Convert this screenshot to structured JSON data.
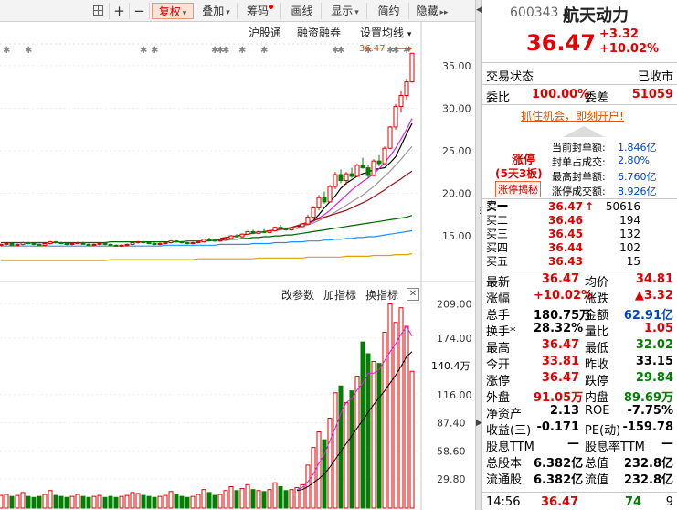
{
  "toolbar": {
    "buttons": [
      {
        "label": "",
        "name": "layout-button",
        "icon": "grid-icon"
      },
      {
        "label": "+",
        "name": "zoom-in-button"
      },
      {
        "label": "−",
        "name": "zoom-out-button"
      },
      {
        "label": "复权",
        "name": "adjust-button",
        "caret": "▾",
        "active": true
      },
      {
        "label": "叠加",
        "name": "overlay-button",
        "caret": "▾"
      },
      {
        "label": "筹码",
        "name": "chips-button",
        "dot": true
      },
      {
        "label": "画线",
        "name": "draw-button"
      },
      {
        "label": "显示",
        "name": "display-button",
        "caret": "▾"
      },
      {
        "label": "简约",
        "name": "simple-button"
      },
      {
        "label": "隐藏",
        "name": "hide-button",
        "caret": "▸▸"
      }
    ]
  },
  "main_chart": {
    "links": [
      "沪股通",
      "融资融券",
      "设置均线"
    ],
    "setting_caret": "▾",
    "last_price_label": "36.47",
    "star_marker": "✱",
    "y_ticks": [
      "35.00",
      "30.00",
      "25.00",
      "20.00",
      "15.00"
    ],
    "y_tick_values": [
      35,
      30,
      25,
      20,
      15
    ],
    "colors": {
      "up": "#e00000",
      "down": "#008000",
      "ma5": "#000000",
      "ma10": "#e020e0",
      "ma20": "#9a9a9a",
      "ma30": "#a01010",
      "ma60": "#006400",
      "ma120": "#1e90ff",
      "ma250": "#e0a000"
    }
  },
  "volume_chart": {
    "links": [
      "改参数",
      "加指标",
      "换指标"
    ],
    "close_icon": "✕",
    "y_ticks": [
      "209.00",
      "174.00",
      "116.00",
      "87.40",
      "58.60",
      "29.80"
    ],
    "y_tick_values": [
      209,
      174,
      116,
      87.4,
      58.6,
      29.8
    ],
    "current_label": "140.4万"
  },
  "chart_data": {
    "type": "candlestick",
    "price_ylim": [
      12,
      38
    ],
    "volume_ylim": [
      0,
      215
    ],
    "candles": [
      [
        13.9,
        14.1,
        13.8,
        14.0,
        13
      ],
      [
        14.0,
        14.2,
        13.9,
        14.1,
        14
      ],
      [
        14.1,
        14.2,
        13.9,
        13.9,
        12
      ],
      [
        13.9,
        14.1,
        13.8,
        14.0,
        13
      ],
      [
        14.0,
        14.3,
        13.9,
        14.2,
        16
      ],
      [
        14.2,
        14.3,
        14.0,
        14.1,
        12
      ],
      [
        14.1,
        14.2,
        13.9,
        14.0,
        11
      ],
      [
        14.0,
        14.1,
        13.8,
        13.9,
        12
      ],
      [
        13.9,
        14.2,
        13.8,
        14.1,
        14
      ],
      [
        14.1,
        14.4,
        14.0,
        14.3,
        18
      ],
      [
        14.3,
        14.4,
        14.1,
        14.2,
        13
      ],
      [
        14.2,
        14.3,
        14.0,
        14.1,
        12
      ],
      [
        14.1,
        14.2,
        13.9,
        14.0,
        11
      ],
      [
        14.0,
        14.2,
        13.9,
        14.1,
        12
      ],
      [
        14.1,
        14.3,
        14.0,
        14.2,
        14
      ],
      [
        14.2,
        14.3,
        14.0,
        14.0,
        12
      ],
      [
        14.0,
        14.1,
        13.8,
        13.9,
        11
      ],
      [
        13.9,
        14.1,
        13.8,
        14.0,
        12
      ],
      [
        14.0,
        14.2,
        13.9,
        14.1,
        13
      ],
      [
        14.1,
        14.2,
        13.9,
        14.0,
        11
      ],
      [
        14.0,
        14.1,
        13.8,
        13.9,
        12
      ],
      [
        13.9,
        14.0,
        13.7,
        13.8,
        11
      ],
      [
        13.8,
        14.0,
        13.7,
        13.9,
        12
      ],
      [
        13.9,
        14.1,
        13.8,
        14.0,
        13
      ],
      [
        14.0,
        14.3,
        13.9,
        14.2,
        16
      ],
      [
        14.2,
        14.4,
        14.1,
        14.3,
        15
      ],
      [
        14.3,
        14.4,
        14.1,
        14.2,
        13
      ],
      [
        14.2,
        14.3,
        14.0,
        14.1,
        12
      ],
      [
        14.1,
        14.2,
        13.9,
        14.0,
        11
      ],
      [
        14.0,
        14.2,
        13.9,
        14.1,
        12
      ],
      [
        14.1,
        14.3,
        14.0,
        14.2,
        13
      ],
      [
        14.2,
        14.5,
        14.1,
        14.4,
        17
      ],
      [
        14.4,
        14.5,
        14.2,
        14.3,
        14
      ],
      [
        14.3,
        14.4,
        14.1,
        14.2,
        12
      ],
      [
        14.2,
        14.3,
        14.0,
        14.1,
        11
      ],
      [
        14.1,
        14.3,
        14.0,
        14.2,
        12
      ],
      [
        14.2,
        14.4,
        14.1,
        14.3,
        14
      ],
      [
        14.3,
        14.7,
        14.2,
        14.6,
        19
      ],
      [
        14.6,
        14.8,
        14.4,
        14.5,
        16
      ],
      [
        14.5,
        14.6,
        14.3,
        14.4,
        13
      ],
      [
        14.4,
        14.6,
        14.3,
        14.5,
        14
      ],
      [
        14.5,
        14.8,
        14.4,
        14.7,
        18
      ],
      [
        14.7,
        15.1,
        14.6,
        15.0,
        22
      ],
      [
        15.0,
        15.2,
        14.8,
        14.9,
        18
      ],
      [
        14.9,
        15.3,
        14.8,
        15.2,
        20
      ],
      [
        15.2,
        15.6,
        15.1,
        15.5,
        24
      ],
      [
        15.5,
        15.7,
        15.2,
        15.3,
        19
      ],
      [
        15.3,
        15.6,
        15.2,
        15.5,
        18
      ],
      [
        15.5,
        15.8,
        15.3,
        15.4,
        17
      ],
      [
        15.4,
        15.7,
        15.3,
        15.6,
        19
      ],
      [
        15.6,
        16.1,
        15.5,
        16.0,
        26
      ],
      [
        16.0,
        16.3,
        15.8,
        15.9,
        22
      ],
      [
        15.9,
        16.0,
        15.6,
        15.7,
        18
      ],
      [
        15.7,
        16.0,
        15.6,
        15.9,
        19
      ],
      [
        15.9,
        16.2,
        15.8,
        16.1,
        21
      ],
      [
        16.1,
        16.5,
        16.0,
        16.4,
        24
      ],
      [
        16.4,
        17.5,
        16.3,
        17.2,
        44
      ],
      [
        17.2,
        18.5,
        17.0,
        18.3,
        62
      ],
      [
        18.3,
        19.8,
        18.0,
        19.5,
        78
      ],
      [
        19.5,
        20.2,
        18.8,
        19.0,
        70
      ],
      [
        19.0,
        21.0,
        18.9,
        20.8,
        92
      ],
      [
        20.8,
        22.5,
        20.5,
        22.2,
        118
      ],
      [
        22.2,
        22.8,
        21.2,
        21.5,
        125
      ],
      [
        21.5,
        22.5,
        21.0,
        22.3,
        108
      ],
      [
        22.3,
        23.0,
        21.8,
        22.0,
        120
      ],
      [
        22.0,
        23.5,
        21.9,
        23.3,
        135
      ],
      [
        23.3,
        24.2,
        22.9,
        23.0,
        170
      ],
      [
        23.0,
        23.4,
        21.8,
        22.1,
        158
      ],
      [
        22.1,
        24.0,
        22.0,
        23.8,
        150
      ],
      [
        23.8,
        24.5,
        23.2,
        23.5,
        148
      ],
      [
        23.5,
        25.5,
        23.4,
        25.3,
        180
      ],
      [
        25.3,
        27.9,
        25.2,
        27.8,
        209
      ],
      [
        27.8,
        30.5,
        27.5,
        30.2,
        190
      ],
      [
        30.2,
        32.0,
        29.5,
        31.5,
        205
      ],
      [
        31.5,
        33.5,
        31.0,
        33.1,
        186
      ],
      [
        33.1,
        36.47,
        33.0,
        36.47,
        140
      ]
    ],
    "ma_lines": [
      {
        "key": "ma5",
        "from": 54,
        "values": [
          16.1,
          16.2,
          16.4,
          16.8,
          17.5,
          18.3,
          19.0,
          19.7,
          20.6,
          21.2,
          21.6,
          22.0,
          22.3,
          22.5,
          22.8,
          22.9,
          23.0,
          23.6,
          24.3,
          25.6,
          27.0,
          28.2
        ]
      },
      {
        "key": "ma10",
        "from": 52,
        "values": [
          15.8,
          15.9,
          16.0,
          16.1,
          16.4,
          16.7,
          17.1,
          17.5,
          18.0,
          18.6,
          19.2,
          19.8,
          20.4,
          20.9,
          21.4,
          21.8,
          22.3,
          22.9,
          23.6,
          24.4,
          25.3,
          26.4,
          27.5,
          28.8
        ]
      },
      {
        "key": "ma20",
        "from": 50,
        "values": [
          15.6,
          15.7,
          15.8,
          15.9,
          16.0,
          16.1,
          16.3,
          16.5,
          16.8,
          17.1,
          17.4,
          17.8,
          18.2,
          18.6,
          19.0,
          19.4,
          19.8,
          20.3,
          20.8,
          21.4,
          22.0,
          22.6,
          23.3,
          24.0,
          24.8,
          25.5
        ]
      },
      {
        "key": "ma30",
        "from": 40,
        "values": [
          14.7,
          14.8,
          14.9,
          15.0,
          15.1,
          15.2,
          15.3,
          15.4,
          15.5,
          15.6,
          15.7,
          15.8,
          15.9,
          16.0,
          16.2,
          16.4,
          16.6,
          16.8,
          17.0,
          17.2,
          17.4,
          17.6,
          17.8,
          18.0,
          18.3,
          18.6,
          18.9,
          19.2,
          19.6,
          20.0,
          20.4,
          20.9,
          21.3,
          21.7,
          22.2,
          22.6
        ]
      },
      {
        "key": "ma60",
        "from": 0,
        "values": [
          14.2,
          14.2,
          14.2,
          14.2,
          14.2,
          14.2,
          14.2,
          14.2,
          14.2,
          14.2,
          14.2,
          14.2,
          14.2,
          14.2,
          14.2,
          14.2,
          14.2,
          14.2,
          14.2,
          14.2,
          14.3,
          14.3,
          14.3,
          14.3,
          14.3,
          14.3,
          14.3,
          14.3,
          14.3,
          14.3,
          14.3,
          14.3,
          14.3,
          14.3,
          14.4,
          14.4,
          14.4,
          14.4,
          14.4,
          14.5,
          14.5,
          14.5,
          14.6,
          14.6,
          14.7,
          14.7,
          14.8,
          14.8,
          14.9,
          14.9,
          15.0,
          15.0,
          15.1,
          15.1,
          15.2,
          15.3,
          15.4,
          15.5,
          15.6,
          15.7,
          15.8,
          15.9,
          16.0,
          16.1,
          16.2,
          16.3,
          16.4,
          16.5,
          16.6,
          16.7,
          16.8,
          16.9,
          17.0,
          17.1,
          17.2,
          17.4
        ]
      },
      {
        "key": "ma120",
        "from": 0,
        "values": [
          13.8,
          13.8,
          13.8,
          13.8,
          13.8,
          13.8,
          13.8,
          13.8,
          13.8,
          13.8,
          13.8,
          13.8,
          13.8,
          13.8,
          13.8,
          13.8,
          13.8,
          13.8,
          13.8,
          13.8,
          13.8,
          13.8,
          13.8,
          13.8,
          13.8,
          13.8,
          13.8,
          13.8,
          13.8,
          13.8,
          13.9,
          13.9,
          13.9,
          13.9,
          13.9,
          13.9,
          13.9,
          13.9,
          13.9,
          13.9,
          14.0,
          14.0,
          14.0,
          14.0,
          14.0,
          14.0,
          14.1,
          14.1,
          14.1,
          14.1,
          14.2,
          14.2,
          14.2,
          14.3,
          14.3,
          14.3,
          14.4,
          14.4,
          14.4,
          14.5,
          14.5,
          14.6,
          14.6,
          14.7,
          14.7,
          14.8,
          14.8,
          14.9,
          14.9,
          15.0,
          15.1,
          15.2,
          15.3,
          15.4,
          15.5,
          15.6
        ]
      },
      {
        "key": "ma250",
        "from": 0,
        "values": [
          12.1,
          12.1,
          12.1,
          12.1,
          12.1,
          12.1,
          12.1,
          12.1,
          12.1,
          12.1,
          12.1,
          12.1,
          12.1,
          12.1,
          12.1,
          12.1,
          12.1,
          12.1,
          12.1,
          12.1,
          12.2,
          12.2,
          12.2,
          12.2,
          12.2,
          12.2,
          12.2,
          12.2,
          12.2,
          12.2,
          12.2,
          12.2,
          12.2,
          12.2,
          12.2,
          12.2,
          12.3,
          12.3,
          12.3,
          12.3,
          12.3,
          12.3,
          12.3,
          12.3,
          12.3,
          12.3,
          12.3,
          12.4,
          12.4,
          12.4,
          12.4,
          12.4,
          12.4,
          12.4,
          12.4,
          12.4,
          12.5,
          12.5,
          12.5,
          12.5,
          12.5,
          12.5,
          12.5,
          12.6,
          12.6,
          12.6,
          12.6,
          12.6,
          12.7,
          12.7,
          12.7,
          12.7,
          12.8,
          12.8,
          12.8,
          12.9
        ]
      }
    ],
    "vol_ma": [
      {
        "color": "#e020e0",
        "from": 54,
        "values": [
          19,
          21,
          27,
          35,
          46,
          55,
          69,
          82,
          97,
          108,
          112,
          121,
          128,
          138,
          138,
          142,
          151,
          160,
          168,
          178,
          186,
          176
        ]
      },
      {
        "color": "#000000",
        "from": 54,
        "values": [
          18,
          19,
          22,
          26,
          30,
          35,
          42,
          50,
          58,
          66,
          74,
          82,
          90,
          98,
          106,
          113,
          120,
          128,
          136,
          145,
          155,
          160
        ]
      }
    ],
    "star_candles": [
      1,
      5,
      26,
      28,
      39,
      40,
      41,
      44,
      48,
      61,
      62,
      67,
      71,
      72,
      74
    ]
  },
  "quote": {
    "code": "600343",
    "name": "航天动力",
    "price": "36.47",
    "change": "+3.32",
    "change_pct": "+10.02%",
    "status_label": "交易状态",
    "status_value": "已收市",
    "ratio_label": "委比",
    "ratio_value": "100.00%",
    "diff_label": "委差",
    "diff_value": "51059",
    "promo": "抓住机会，即刻开户!",
    "limit": {
      "tag": "涨停",
      "sub": "(5天3板)",
      "link": "涨停揭秘",
      "lines": [
        {
          "label": "当前封单额:",
          "value": "1.846亿"
        },
        {
          "label": "封单占成交:",
          "value": "2.80%"
        },
        {
          "label": "最高封单额:",
          "value": "6.760亿"
        },
        {
          "label": "涨停成交额:",
          "value": "8.926亿"
        }
      ]
    },
    "book": [
      {
        "label": "卖一",
        "price": "",
        "vol": ""
      },
      {
        "label": "买一",
        "price": "36.47",
        "arrow": "↑",
        "vol": "50616"
      },
      {
        "label": "买二",
        "price": "36.46",
        "vol": "194"
      },
      {
        "label": "买三",
        "price": "36.45",
        "vol": "132"
      },
      {
        "label": "买四",
        "price": "36.44",
        "vol": "102"
      },
      {
        "label": "买五",
        "price": "36.43",
        "vol": "15"
      }
    ],
    "stats": [
      [
        {
          "l": "最新",
          "v": "36.47",
          "c": "red"
        },
        {
          "l": "均价",
          "v": "34.81",
          "c": "red"
        }
      ],
      [
        {
          "l": "涨幅",
          "v": "+10.02%",
          "c": "red"
        },
        {
          "l": "涨跌",
          "v": "▲3.32",
          "c": "red"
        }
      ],
      [
        {
          "l": "总手",
          "v": "180.75万",
          "c": "black"
        },
        {
          "l": "金额",
          "v": "62.91亿",
          "c": "blue"
        }
      ],
      [
        {
          "l": "换手*",
          "v": "28.32%",
          "c": "black"
        },
        {
          "l": "量比",
          "v": "1.05",
          "c": "red"
        }
      ],
      [
        {
          "l": "最高",
          "v": "36.47",
          "c": "red"
        },
        {
          "l": "最低",
          "v": "32.02",
          "c": "green"
        }
      ],
      [
        {
          "l": "今开",
          "v": "33.81",
          "c": "red"
        },
        {
          "l": "昨收",
          "v": "33.15",
          "c": "black"
        }
      ],
      [
        {
          "l": "涨停",
          "v": "36.47",
          "c": "red"
        },
        {
          "l": "跌停",
          "v": "29.84",
          "c": "green"
        }
      ],
      [
        {
          "l": "外盘",
          "v": "91.05万",
          "c": "red"
        },
        {
          "l": "内盘",
          "v": "89.69万",
          "c": "green"
        }
      ],
      [
        {
          "l": "净资产",
          "v": "2.13",
          "c": "black"
        },
        {
          "l": "ROE",
          "v": "-7.75%",
          "c": "black"
        }
      ],
      [
        {
          "l": "收益(三)",
          "v": "-0.171",
          "c": "black"
        },
        {
          "l": "PE(动)",
          "v": "-159.78",
          "c": "black"
        }
      ],
      [
        {
          "l": "股息TTM",
          "v": "—",
          "c": "black"
        },
        {
          "l": "股息率TTM",
          "v": "—",
          "c": "black"
        }
      ],
      [
        {
          "l": "总股本",
          "v": "6.382亿",
          "c": "black"
        },
        {
          "l": "总值",
          "v": "232.8亿",
          "c": "black"
        }
      ],
      [
        {
          "l": "流通股",
          "v": "6.382亿",
          "c": "black"
        },
        {
          "l": "流值",
          "v": "232.8亿",
          "c": "black"
        }
      ]
    ],
    "tick": {
      "time": "14:56",
      "price": "36.47",
      "vol": "74",
      "count": "9"
    }
  }
}
